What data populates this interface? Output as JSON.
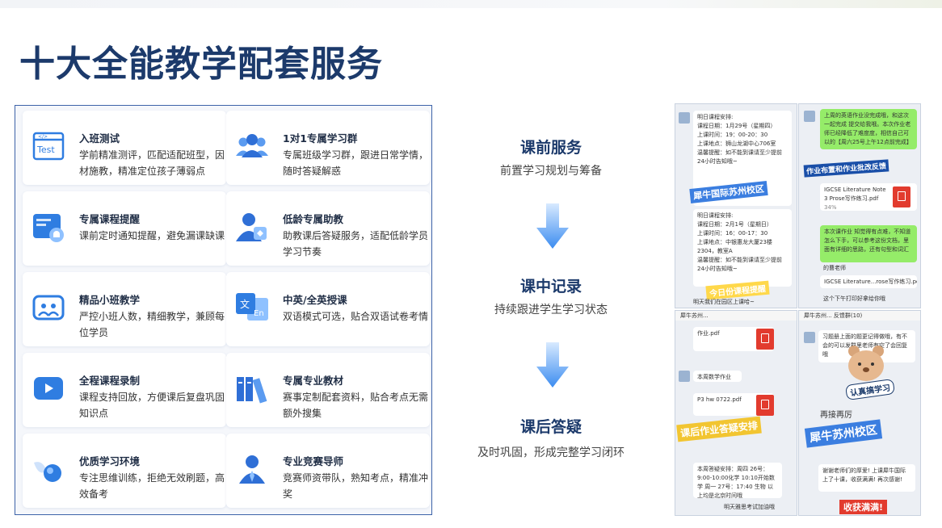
{
  "page": {
    "title": "十大全能教学配套服务"
  },
  "services": [
    {
      "title": "入班测试",
      "desc": "学前精准测评，匹配适配班型，因材施教，精准定位孩子薄弱点",
      "icon": "test-icon",
      "icon_text": "Test"
    },
    {
      "title": "1对1专属学习群",
      "desc": "专属班级学习群，跟进日常学情，随时答疑解惑",
      "icon": "group-icon"
    },
    {
      "title": "专属课程提醒",
      "desc": "课前定时通知提醒，避免漏课缺课",
      "icon": "bell-icon"
    },
    {
      "title": "低龄专属助教",
      "desc": "助教课后答疑服务，适配低龄学员学习节奏",
      "icon": "assistant-icon"
    },
    {
      "title": "精品小班教学",
      "desc": "严控小班人数，精细教学，兼顾每位学员",
      "icon": "small-class-icon"
    },
    {
      "title": "中英/全英授课",
      "desc": "双语模式可选，贴合双语试卷考情",
      "icon": "translate-icon",
      "icon_text_a": "文",
      "icon_text_b": "En"
    },
    {
      "title": "全程课程录制",
      "desc": "课程支持回放，方便课后复盘巩固知识点",
      "icon": "video-icon"
    },
    {
      "title": "专属专业教材",
      "desc": "赛事定制配套资料，贴合考点无需额外搜集",
      "icon": "books-icon"
    },
    {
      "title": "优质学习环境",
      "desc": "专注思维训练，拒绝无效刷题，高效备考",
      "icon": "environment-icon"
    },
    {
      "title": "专业竞赛导师",
      "desc": "竞赛师资带队，熟知考点，精准冲奖",
      "icon": "mentor-icon"
    }
  ],
  "flow": [
    {
      "title": "课前服务",
      "sub": "前置学习规划与筹备"
    },
    {
      "title": "课中记录",
      "sub": "持续跟进学生学习状态"
    },
    {
      "title": "课后答疑",
      "sub": "及时巩固，形成完整学习闭环"
    }
  ],
  "colors": {
    "accent": "#1c3a6b",
    "icon_blue": "#2f7de1",
    "border": "#3d63a8"
  },
  "screenshots": {
    "s1": {
      "header": "明日课程安排:",
      "date1": "课程日期：1月29号（星期四）",
      "time1": "上课时间：19：00-20：30",
      "place1": "上课地点：狮山龙湖中心706室",
      "tip1": "温馨提醒：如不能到课请至少提前24小时告知哦~",
      "date2": "课程日期：2月1号（星期日）",
      "time2": "上课时间：16：00-17：30",
      "place2": "上课地点：中银惠龙大厦23楼2304，教室A",
      "tip2": "温馨提醒：如不能到课请至少提前24小时告知哦~",
      "sticker_a": "犀牛国际苏州校区",
      "sticker_b": "今日份课程提醒",
      "footer": "明天我们在园区上课哈~"
    },
    "s2": {
      "msg1": "上周的英语作业没完成哦，和这次一起完成 提交给我哦。本次作业老师已经降低了难度度，相信自己可以的【周六25号上午12点前完成】",
      "sticker": "作业布置和作业批改反馈",
      "file_name": "IGCSE Literature Note 3 Prose写作练习.pdf",
      "file_size": "34%",
      "msg2": "本次课作业 知觉得有点难，不知道怎么下手，可以参考这份文档，里面有详细的思路，还有句型和词汇",
      "sender": "的曹老师",
      "file2": "IGCSE Literature...rose写作练习.pdf",
      "msg3": "这个下午打印好拿给你哦"
    },
    "s3": {
      "title": "犀牛苏州...",
      "file1": "作业.pdf",
      "msg1": "本周数学作业",
      "file2": "P3 hw 0722.pdf",
      "sticker": "课后作业答疑安排",
      "schedule": "本周答疑安排：周四 26号：9:00-10:00化学 10:10开始数学 周一 27号：17:40 生物 以上均是北京时间哦",
      "footer": "明天雅思考试加油哦"
    },
    "s4": {
      "title": "犀牛苏州... 反馈群(10)",
      "msg1": "习题册上面的题更记得做哦，有不会的可以发群里老师有空了会回复哦",
      "sticker_a": "认真搞学习",
      "handwriting": "再接再厉",
      "sticker_b": "犀牛苏州校区",
      "msg2": "谢谢老师们的厚爱! 上课犀牛国际上了十课，收获满满! 再次感谢!",
      "sticker_c": "收获满满!"
    }
  }
}
